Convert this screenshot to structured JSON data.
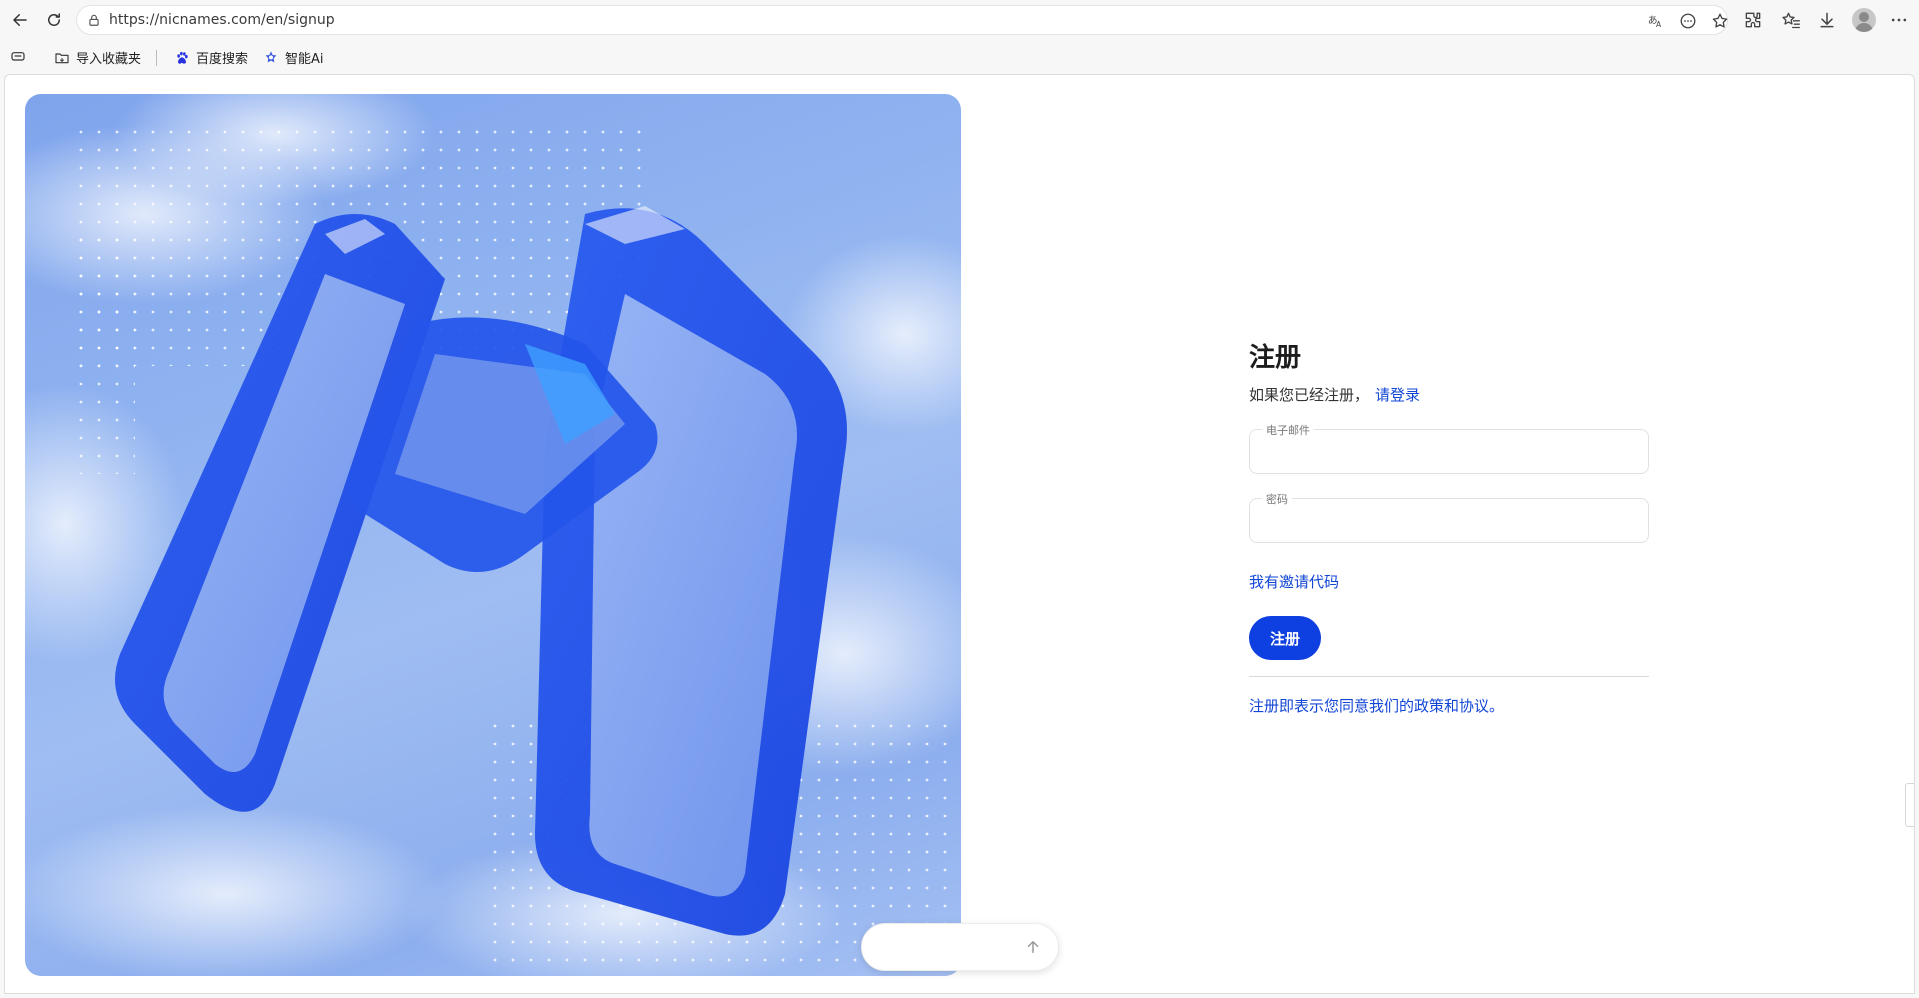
{
  "browser": {
    "url": "https://nicnames.com/en/signup",
    "bookmarks": [
      {
        "label": "导入收藏夹",
        "icon": "folder-import-icon"
      },
      {
        "label": "百度搜索",
        "icon": "baidu-paw-icon"
      },
      {
        "label": "智能Ai",
        "icon": "ai-star-icon"
      }
    ]
  },
  "form": {
    "title": "注册",
    "subtitle_prefix": "如果您已经注册，",
    "login_link": "请登录",
    "email_label": "电子邮件",
    "email_value": "",
    "password_label": "密码",
    "password_value": "",
    "invite_link": "我有邀请代码",
    "submit_label": "注册",
    "policy_text": "注册即表示您同意我们的政策和协议。"
  },
  "colors": {
    "accent": "#0e3fe0",
    "link": "#1246d6"
  }
}
